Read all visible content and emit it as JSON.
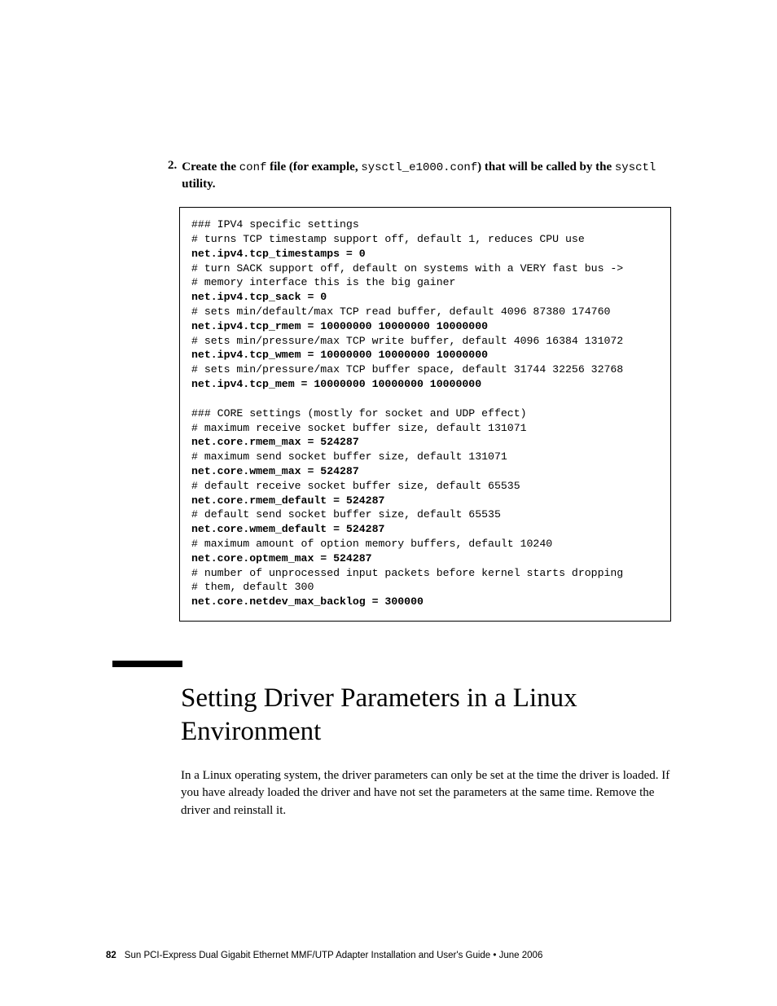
{
  "step": {
    "number": "2.",
    "t1": "Create the ",
    "c1": "conf",
    "t2": " file (for example, ",
    "c2": "sysctl_e1000.conf",
    "t3": ") that will be called by the ",
    "c3": "sysctl",
    "t4": " utility."
  },
  "code": {
    "l01": "### IPV4 specific settings",
    "l02": "# turns TCP timestamp support off, default 1, reduces CPU use",
    "l03": "net.ipv4.tcp_timestamps = 0",
    "l04": "# turn SACK support off, default on systems with a VERY fast bus ->",
    "l05": "# memory interface this is the big gainer",
    "l06": "net.ipv4.tcp_sack = 0",
    "l07": "# sets min/default/max TCP read buffer, default 4096 87380 174760",
    "l08": "net.ipv4.tcp_rmem = 10000000 10000000 10000000",
    "l09": "# sets min/pressure/max TCP write buffer, default 4096 16384 131072",
    "l10": "net.ipv4.tcp_wmem = 10000000 10000000 10000000",
    "l11": "# sets min/pressure/max TCP buffer space, default 31744 32256 32768",
    "l12": "net.ipv4.tcp_mem = 10000000 10000000 10000000",
    "l13": "",
    "l14": "### CORE settings (mostly for socket and UDP effect)",
    "l15": "# maximum receive socket buffer size, default 131071",
    "l16": "net.core.rmem_max = 524287",
    "l17": "# maximum send socket buffer size, default 131071",
    "l18": "net.core.wmem_max = 524287",
    "l19": "# default receive socket buffer size, default 65535",
    "l20": "net.core.rmem_default = 524287",
    "l21": "# default send socket buffer size, default 65535",
    "l22": "net.core.wmem_default = 524287",
    "l23": "# maximum amount of option memory buffers, default 10240",
    "l24": "net.core.optmem_max = 524287",
    "l25": "# number of unprocessed input packets before kernel starts dropping",
    "l26": "# them, default 300",
    "l27": "net.core.netdev_max_backlog = 300000"
  },
  "section": {
    "title": "Setting Driver Parameters in a Linux Environment",
    "para": "In a Linux operating system, the driver parameters can only be set at the time the driver is loaded. If you have already loaded the driver and have not set the parameters at the same time. Remove the driver and reinstall it."
  },
  "footer": {
    "page": "82",
    "text": "Sun PCI-Express Dual Gigabit Ethernet MMF/UTP Adapter Installation and User's Guide  •  June 2006"
  }
}
